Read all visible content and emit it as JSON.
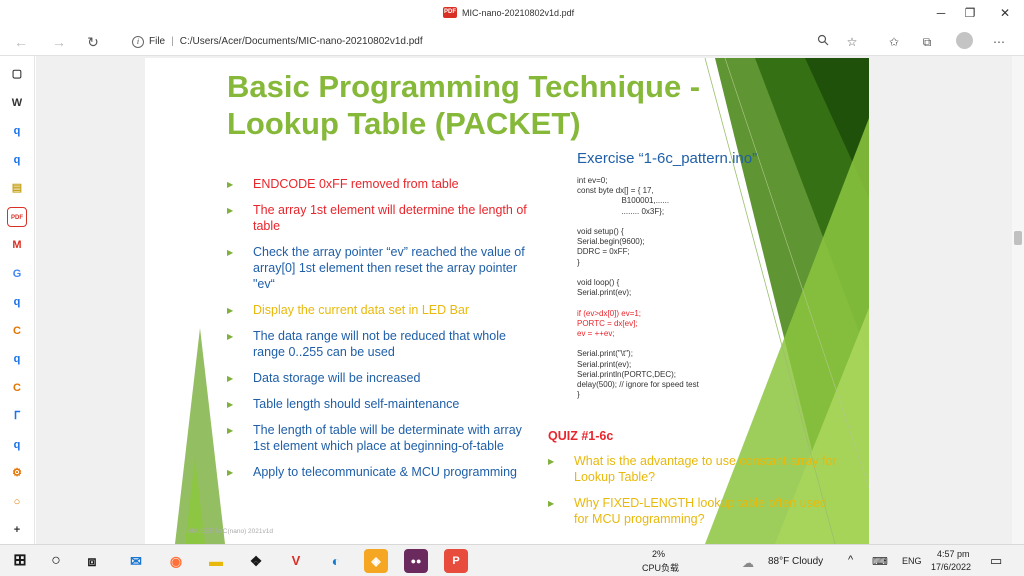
{
  "window": {
    "title": "MIC-nano-20210802v1d.pdf",
    "pdf_badge": "PDF",
    "minimize": "─",
    "maximize": "❐",
    "close": "✕"
  },
  "addressbar": {
    "back": "←",
    "forward": "→",
    "refresh": "↻",
    "info": "i",
    "scheme_label": "File",
    "url": "C:/Users/Acer/Documents/MIC-nano-20210802v1d.pdf"
  },
  "sidebar": {
    "items": [
      {
        "icon": "tab-icon",
        "glyph": "▢",
        "color": "#333333"
      },
      {
        "icon": "word-icon",
        "glyph": "W",
        "color": "#333333"
      },
      {
        "icon": "search-icon",
        "glyph": "q",
        "color": "#1a73e8"
      },
      {
        "icon": "search-icon",
        "glyph": "q",
        "color": "#1a73e8"
      },
      {
        "icon": "app-icon",
        "glyph": "▤",
        "color": "#c7a31e"
      },
      {
        "icon": "pdf-icon",
        "glyph": "PDF",
        "color": "#d93025"
      },
      {
        "icon": "gmail-icon",
        "glyph": "M",
        "color": "#d93025"
      },
      {
        "icon": "google-icon",
        "glyph": "G",
        "color": "#4285f4"
      },
      {
        "icon": "search-icon",
        "glyph": "q",
        "color": "#1a73e8"
      },
      {
        "icon": "c-app-icon",
        "glyph": "C",
        "color": "#e37400"
      },
      {
        "icon": "search-icon",
        "glyph": "q",
        "color": "#1a73e8"
      },
      {
        "icon": "c-app-icon",
        "glyph": "C",
        "color": "#e37400"
      },
      {
        "icon": "loading-icon",
        "glyph": "ᒥ",
        "color": "#1a73e8"
      },
      {
        "icon": "search-icon",
        "glyph": "q",
        "color": "#1a73e8"
      },
      {
        "icon": "settings-icon",
        "glyph": "⚙",
        "color": "#e37400"
      },
      {
        "icon": "circle-icon",
        "glyph": "○",
        "color": "#e37400"
      },
      {
        "icon": "add-icon",
        "glyph": "+",
        "color": "#333333"
      }
    ]
  },
  "slide": {
    "title": "Basic Programming Technique - Lookup Table (PACKET)",
    "bullets": [
      {
        "text": "ENDCODE 0xFF removed from table",
        "color": "red"
      },
      {
        "text": "The array 1st element will determine the length of table",
        "color": "red"
      },
      {
        "text": "Check the array pointer “ev” reached the value of array[0] 1st element then reset the array pointer \"ev“",
        "color": "blue"
      },
      {
        "text": "Display the current data set in LED Bar",
        "color": "yellow"
      },
      {
        "text": "The data range will not be reduced that whole range 0..255 can be used",
        "color": "blue"
      },
      {
        "text": "Data storage will be increased",
        "color": "blue"
      },
      {
        "text": "Table length should self-maintenance",
        "color": "blue"
      },
      {
        "text": "The length of table will be determinate with array 1st element which place at beginning-of-table",
        "color": "blue"
      },
      {
        "text": "Apply to telecommunicate & MCU programming",
        "color": "blue"
      }
    ],
    "exercise_title": "Exercise “1-6c_pattern.ino”",
    "code_lines": [
      "int ev=0;",
      "const byte dx[] = { 17,",
      "                    B100001,......",
      "                    ........ 0x3F};",
      "",
      "void setup() {",
      "Serial.begin(9600);",
      "DDRC = 0xFF;",
      "}",
      "",
      "void loop() {",
      "Serial.print(ev);",
      "",
      "if (ev>dx[0]) ev=1;",
      "PORTC = dx[ev];",
      "ev = ++ev;",
      "",
      "Serial.print(\"\\t\");",
      "Serial.print(ev);",
      "Serial.println(PORTC,DEC);",
      "delay(500); // ignore for speed test",
      "}"
    ],
    "quiz_title": "QUIZ #1-6c",
    "quiz_items": [
      "What is the advantage to use constant array for Lookup Table?",
      "Why FIXED-LENGTH lookup table often used for MCU programming?"
    ],
    "footer": "HKUEEE MIC(nano) 2021v1d"
  },
  "colors": {
    "title_green": "#86b83a",
    "red": "#e8262c",
    "blue": "#1f5fa8",
    "yellow": "#e8b90c"
  },
  "taskbar": {
    "cpu_percent": "2%",
    "cpu_label": "CPU负载",
    "weather": "88°F  Cloudy",
    "language": "ENG",
    "time": "4:57 pm",
    "date": "17/6/2022"
  }
}
